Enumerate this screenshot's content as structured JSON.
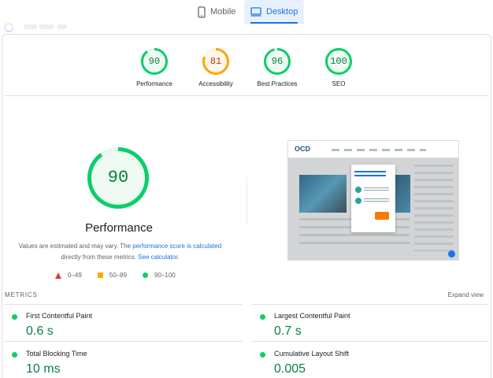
{
  "tabs": [
    {
      "label": "Mobile",
      "icon": "mobile-phone-icon",
      "selected": false
    },
    {
      "label": "Desktop",
      "icon": "desktop-monitor-icon",
      "selected": true
    }
  ],
  "colors": {
    "pass": "#0cce6b",
    "pass_text": "#0b8043",
    "average": "#ffa400",
    "average_text": "#c33300",
    "fail": "#e53935",
    "link": "#1a73e8"
  },
  "summary": [
    {
      "score": "90",
      "value": 90,
      "label": "Performance",
      "rating": "pass"
    },
    {
      "score": "81",
      "value": 81,
      "label": "Accessibility",
      "rating": "average"
    },
    {
      "score": "96",
      "value": 96,
      "label": "Best Practices",
      "rating": "pass"
    },
    {
      "score": "100",
      "value": 100,
      "label": "SEO",
      "rating": "pass"
    }
  ],
  "performance": {
    "score": "90",
    "value": 90,
    "title": "Performance",
    "desc_prefix": "Values are estimated and may vary. The ",
    "desc_link1": "performance score is calculated",
    "desc_mid": " directly from these metrics. ",
    "desc_link2": "See calculator."
  },
  "legend": [
    {
      "shape": "triangle",
      "label": "0–49"
    },
    {
      "shape": "square",
      "label": "50–89"
    },
    {
      "shape": "circle",
      "label": "90–100"
    }
  ],
  "screenshot": {
    "logo": "OCD"
  },
  "metrics": {
    "heading": "METRICS",
    "expand": "Expand view",
    "items": [
      {
        "name": "First Contentful Paint",
        "value": "0.6 s"
      },
      {
        "name": "Largest Contentful Paint",
        "value": "0.7 s"
      },
      {
        "name": "Total Blocking Time",
        "value": "10 ms"
      },
      {
        "name": "Cumulative Layout Shift",
        "value": "0.005"
      }
    ]
  }
}
